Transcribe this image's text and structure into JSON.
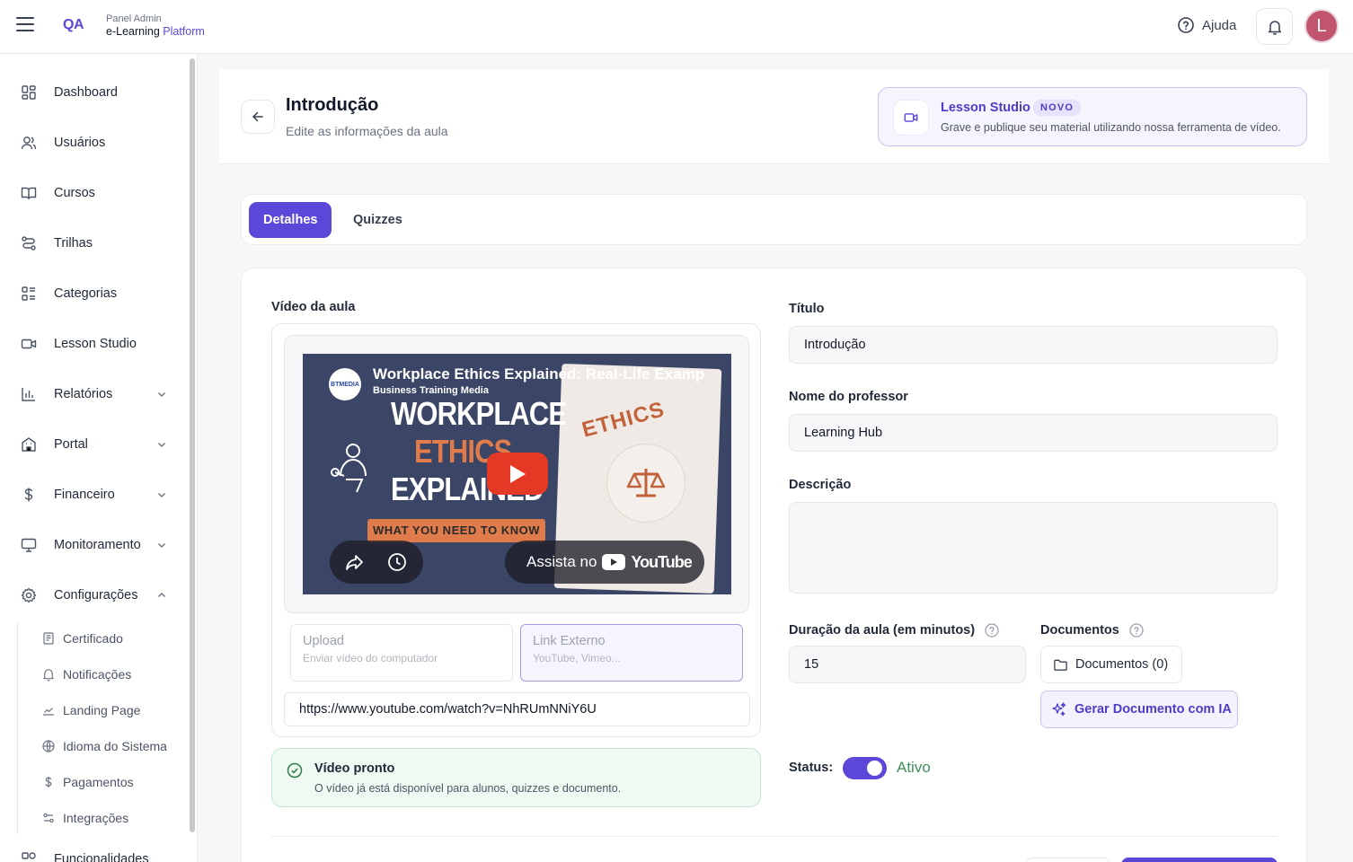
{
  "topbar": {
    "brand_mark": "QA",
    "brand_small": "Panel Admin",
    "brand_main_prefix": "e-Learning",
    "brand_main_accent": "Platform",
    "help_label": "Ajuda",
    "avatar_initial": "L"
  },
  "sidebar": {
    "items": [
      {
        "label": "Dashboard",
        "icon": "grid-icon"
      },
      {
        "label": "Usuários",
        "icon": "users-icon"
      },
      {
        "label": "Cursos",
        "icon": "book-icon"
      },
      {
        "label": "Trilhas",
        "icon": "route-icon"
      },
      {
        "label": "Categorias",
        "icon": "list-icon"
      },
      {
        "label": "Lesson Studio",
        "icon": "video-icon"
      },
      {
        "label": "Relatórios",
        "icon": "bar-chart-icon",
        "expandable": true
      },
      {
        "label": "Portal",
        "icon": "building-icon",
        "expandable": true
      },
      {
        "label": "Financeiro",
        "icon": "dollar-icon",
        "expandable": true
      },
      {
        "label": "Monitoramento",
        "icon": "monitor-icon",
        "expandable": true
      },
      {
        "label": "Configurações",
        "icon": "gear-icon",
        "expanded": true
      }
    ],
    "sub_items": [
      {
        "label": "Certificado",
        "icon": "certificate-icon"
      },
      {
        "label": "Notificações",
        "icon": "bell-icon"
      },
      {
        "label": "Landing Page",
        "icon": "landing-icon"
      },
      {
        "label": "Idioma do Sistema",
        "icon": "globe-icon"
      },
      {
        "label": "Pagamentos",
        "icon": "dollar-icon"
      },
      {
        "label": "Integrações",
        "icon": "integrations-icon"
      }
    ],
    "partial_item": "Funcionalidades"
  },
  "header": {
    "title": "Introdução",
    "subtitle": "Edite as informações da aula",
    "studio": {
      "title": "Lesson Studio",
      "badge": "NOVO",
      "description": "Grave e publique seu material utilizando nossa ferramenta de vídeo."
    }
  },
  "tabs": [
    {
      "label": "Detalhes",
      "active": true
    },
    {
      "label": "Quizzes",
      "active": false
    }
  ],
  "video": {
    "section_label": "Vídeo da aula",
    "player": {
      "title": "Workplace Ethics Explained: Real-Life Examp",
      "channel": "Business Training Media",
      "channel_logo": "BTMEDIA",
      "thumb_line1": "WORKPLACE",
      "thumb_line2": "ETHICS",
      "thumb_line3": "EXPLAINED",
      "thumb_pill": "WHAT YOU NEED TO KNOW",
      "paper_text": "ETHICS",
      "watch_on": "Assista no",
      "youtube_wordmark": "YouTube"
    },
    "sources": [
      {
        "title": "Upload",
        "subtitle": "Enviar vídeo do computador",
        "selected": false
      },
      {
        "title": "Link Externo",
        "subtitle": "YouTube, Vimeo...",
        "selected": true
      }
    ],
    "url_value": "https://www.youtube.com/watch?v=NhRUmNNiY6U",
    "ready": {
      "title": "Vídeo pronto",
      "description": "O vídeo já está disponível para alunos, quizzes e documento."
    }
  },
  "form": {
    "title_label": "Título",
    "title_value": "Introdução",
    "teacher_label": "Nome do professor",
    "teacher_value": "Learning Hub",
    "description_label": "Descrição",
    "description_value": "",
    "duration_label": "Duração da aula (em minutos)",
    "duration_value": "15",
    "documents_label": "Documentos",
    "documents_button": "Documentos (0)",
    "ai_button": "Gerar Documento com IA",
    "status_label": "Status:",
    "status_value": "Ativo",
    "status_on": true
  },
  "colors": {
    "primary": "#5b48d9",
    "success_text": "#3f8f5a",
    "success_bg": "#effaf3",
    "avatar": "#c2546f"
  }
}
